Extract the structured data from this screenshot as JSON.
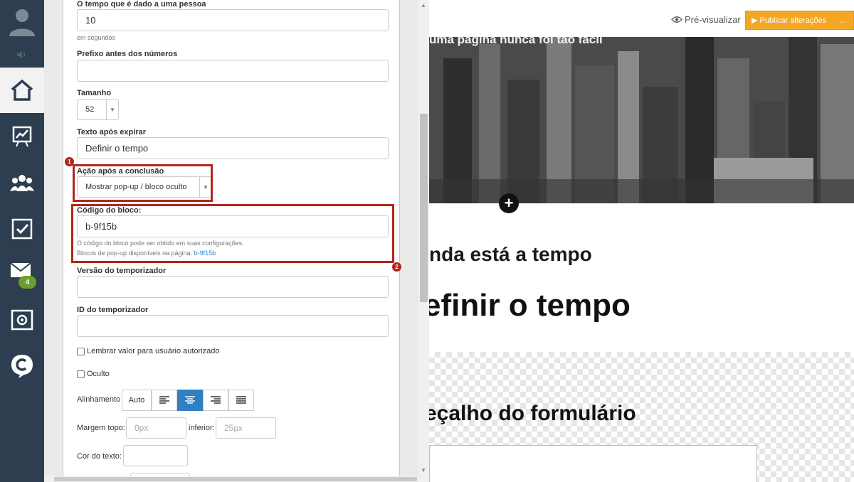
{
  "nav": {
    "mail_badge": "4"
  },
  "form": {
    "time_label": "O tempo que é dado a uma pessoa",
    "time_value": "10",
    "time_hint": "em segundos",
    "prefix_label": "Prefixo antes dos números",
    "prefix_value": "",
    "size_label": "Tamanho",
    "size_value": "52",
    "expire_label": "Texto após expirar",
    "expire_value": "Definir o tempo",
    "action_label": "Ação após a conclusão",
    "action_value": "Mostrar pop-up / bloco oculto",
    "block_code_label": "Código do bloco:",
    "block_code_value": "b-9f15b",
    "block_hint1": "O código do bloco pode ser obtido em suas configurações.",
    "block_hint2_prefix": "Blocos de pop-up disponíveis na página: ",
    "block_hint2_link": "b-9f15b",
    "version_label": "Versão do temporizador",
    "id_label": "ID do temporizador",
    "remember_label": "Lembrar valor para usuário autorizado",
    "hidden_label": "Oculto",
    "align_label": "Alinhamento",
    "align_auto": "Auto",
    "align_selected": "center",
    "margin_label": "Margem topo:",
    "margin_top_placeholder": "0px",
    "bottom_label": "inferior:",
    "margin_bottom_placeholder": "25px",
    "color_label": "Cor do texto:"
  },
  "annotations": {
    "marker1": "1",
    "marker2": "2"
  },
  "preview": {
    "preview_label": "Pré-visualizar",
    "publish_label": "▶ Publicar alterações",
    "publish_more": "...",
    "hero_text": "uma página nunca foi tão fácil",
    "heading_small": "nda está a tempo",
    "heading_big": "efinir o tempo",
    "form_heading": "eçalho do formulário"
  },
  "colors": {
    "nav_bg": "#2c3e50",
    "accent_blue": "#2f7fc1",
    "highlight_red": "#b0271b",
    "publish_orange": "#f5a623"
  }
}
